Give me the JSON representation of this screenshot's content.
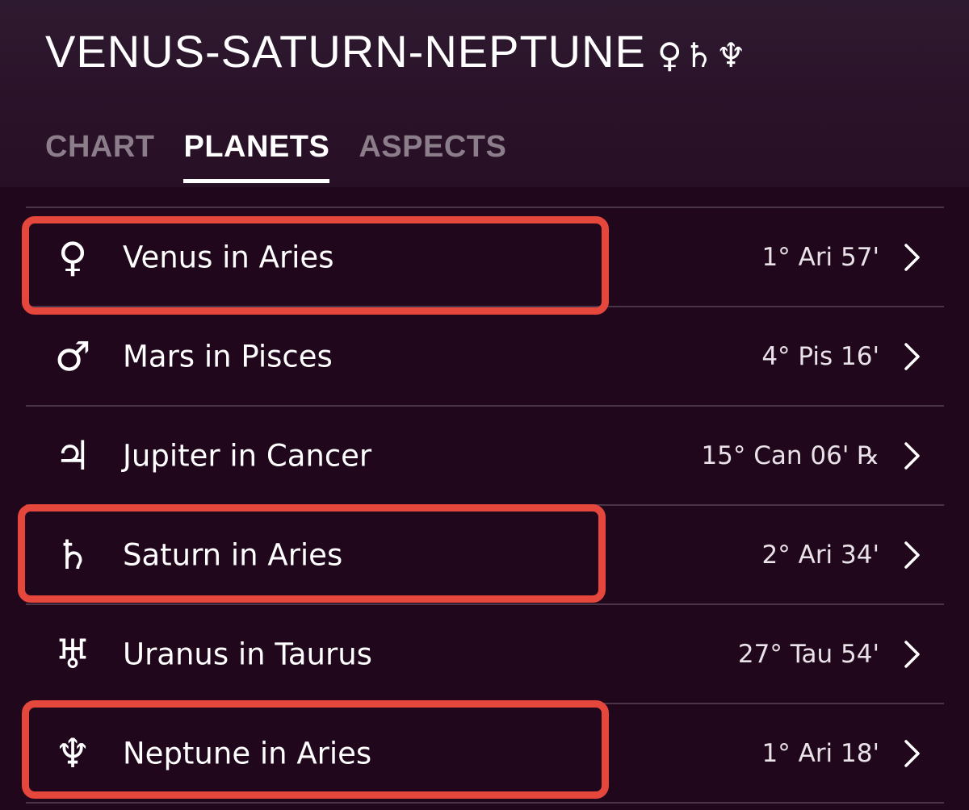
{
  "header": {
    "title": "VENUS-SATURN-NEPTUNE",
    "title_glyphs": "♀♄♆",
    "tabs": [
      {
        "label": "CHART",
        "active": false
      },
      {
        "label": "PLANETS",
        "active": true
      },
      {
        "label": "ASPECTS",
        "active": false
      }
    ]
  },
  "planets": [
    {
      "symbol": "♀",
      "icon": "venus-icon",
      "label": "Venus in Aries",
      "position": "1° Ari 57'",
      "highlighted": true
    },
    {
      "symbol": "♂",
      "icon": "mars-icon",
      "label": "Mars in Pisces",
      "position": "4° Pis 16'",
      "highlighted": false
    },
    {
      "symbol": "♃",
      "icon": "jupiter-icon",
      "label": "Jupiter in Cancer",
      "position": "15° Can 06' ℞",
      "highlighted": false
    },
    {
      "symbol": "♄",
      "icon": "saturn-icon",
      "label": "Saturn in Aries",
      "position": "2° Ari 34'",
      "highlighted": true
    },
    {
      "symbol": "♅",
      "icon": "uranus-icon",
      "label": "Uranus in Taurus",
      "position": "27° Tau 54'",
      "highlighted": false
    },
    {
      "symbol": "♆",
      "icon": "neptune-icon",
      "label": "Neptune in Aries",
      "position": "1° Ari 18'",
      "highlighted": true
    }
  ],
  "colors": {
    "background": "#21071c",
    "header_background": "#2b1429",
    "divider": "#4a3447",
    "highlight_box": "#e5473d",
    "inactive_tab": "#8c7d8b"
  }
}
